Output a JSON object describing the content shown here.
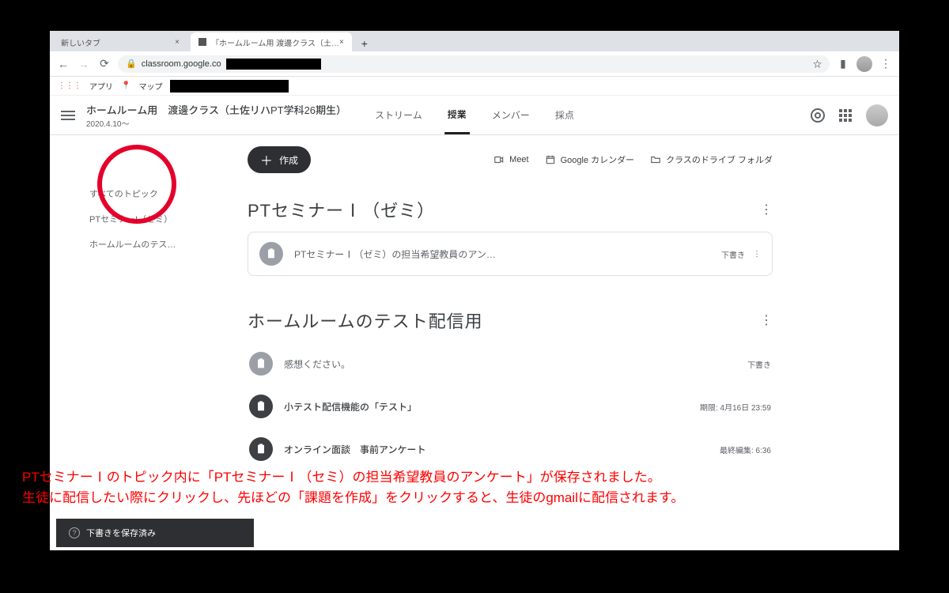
{
  "browser": {
    "tab1": "新しいタブ",
    "tab2_prefix": "『ホームルーム用 渡邊クラス（土…",
    "url_host": "classroom.google.co"
  },
  "bookmarks": {
    "apps": "アプリ",
    "maps": "マップ"
  },
  "header": {
    "title": "ホームルーム用　渡邊クラス（土佐リハPT学科26期生）",
    "subtitle": "2020.4.10〜",
    "tabs": {
      "stream": "ストリーム",
      "classwork": "授業",
      "members": "メンバー",
      "grades": "採点"
    }
  },
  "toolbar": {
    "create": "作成",
    "meet": "Meet",
    "calendar": "Google カレンダー",
    "drive": "クラスのドライブ フォルダ"
  },
  "sidebar": {
    "all": "すべてのトピック",
    "topic1": "PTセミナーI（ゼミ）",
    "topic2": "ホームルームのテス…"
  },
  "section1": {
    "title": "PTセミナーⅠ（ゼミ）",
    "item1_title": "PTセミナーⅠ（ゼミ）の担当希望教員のアン…",
    "item1_meta": "下書き"
  },
  "section2": {
    "title": "ホームルームのテスト配信用",
    "item1_title": "感想ください。",
    "item1_meta": "下書き",
    "item2_title": "小テスト配信機能の「テスト」",
    "item2_meta": "期限: 4月16日 23:59",
    "item3_title": "オンライン面談　事前アンケート",
    "item3_meta": "最終編集: 6:36"
  },
  "annotation": {
    "line1": "PTセミナーⅠのトピック内に「PTセミナーⅠ（セミ）の担当希望教員のアンケート」が保存されました。",
    "line2": "生徒に配信したい際にクリックし、先ほどの「課題を作成」をクリックすると、生徒のgmailに配信されます。"
  },
  "toast": "下書きを保存済み"
}
